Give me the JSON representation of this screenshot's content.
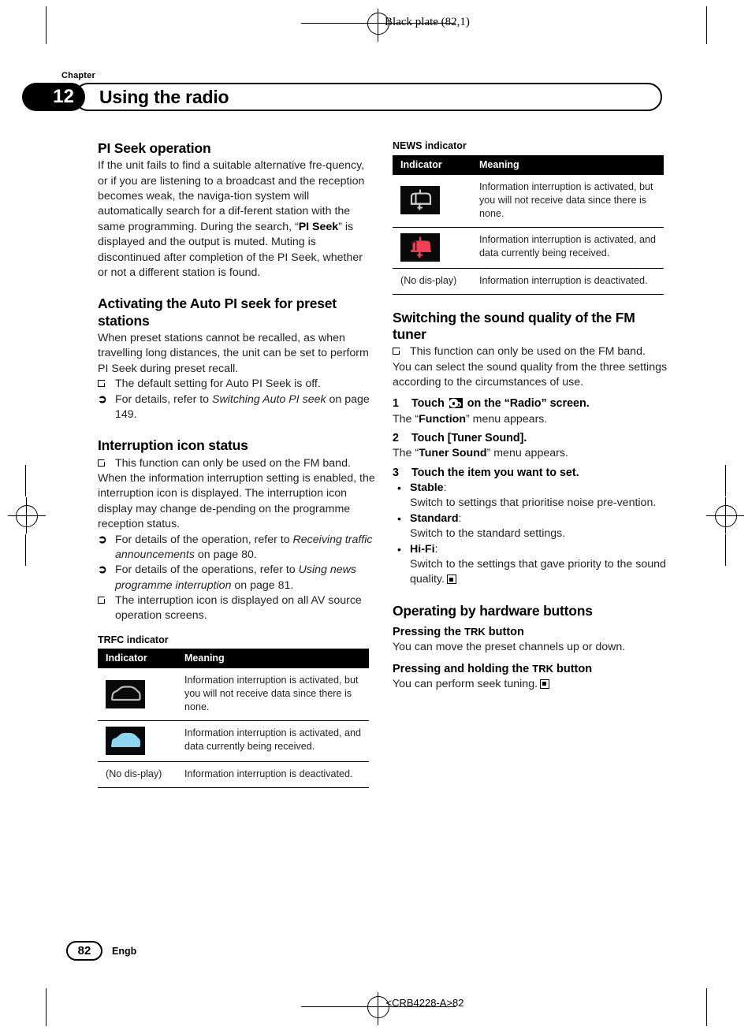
{
  "page": {
    "black_plate": "Black plate (82,1)",
    "chapter_word": "Chapter",
    "chapter_number": "12",
    "chapter_title": "Using the radio",
    "page_number": "82",
    "language_code": "Engb",
    "bottom_code": "<CRB4228-A>82"
  },
  "left_column": {
    "pi_seek": {
      "heading": "PI Seek operation",
      "body_1": "If the unit fails to find a suitable alternative fre-quency, or if you are listening to a broadcast and the reception becomes weak, the naviga-tion system will automatically search for a dif-ferent station with the same programming. During the search, “",
      "bold_1": "PI Seek",
      "body_2": "” is displayed and the output is muted. Muting is discontinued after completion of the PI Seek, whether or not a different station is found."
    },
    "auto_pi": {
      "heading": "Activating the Auto PI seek for preset stations",
      "body": "When preset stations cannot be recalled, as when travelling long distances, the unit can be set to perform PI Seek during preset recall.",
      "note_1": "The default setting for Auto PI Seek is off.",
      "note_2_pre": "For details, refer to ",
      "note_2_italic": "Switching Auto PI seek",
      "note_2_post": " on page 149."
    },
    "interruption": {
      "heading": "Interruption icon status",
      "note_1": "This function can only be used on the FM band.",
      "body": "When the information interruption setting is enabled, the interruption icon is displayed. The interruption icon display may change de-pending on the programme reception status.",
      "note_2_pre": "For details of the operation, refer to ",
      "note_2_italic": "Receiving traffic announcements",
      "note_2_post": " on page 80.",
      "note_3_pre": "For details of the operations, refer to ",
      "note_3_italic": "Using news programme interruption",
      "note_3_post": " on page 81.",
      "note_4": "The interruption icon is displayed on all AV source operation screens."
    },
    "trfc_table": {
      "caption": "TRFC indicator",
      "columns": [
        "Indicator",
        "Meaning"
      ],
      "rows": [
        {
          "icon": "car-outline-icon",
          "icon_label": "",
          "meaning": "Information interruption is activated, but you will not receive data since there is none."
        },
        {
          "icon": "car-filled-icon",
          "icon_label": "",
          "meaning": "Information interruption is activated, and data currently being received."
        },
        {
          "icon": "",
          "icon_label": "(No dis-play)",
          "meaning": "Information interruption is deactivated."
        }
      ]
    }
  },
  "right_column": {
    "news_table": {
      "caption": "NEWS indicator",
      "columns": [
        "Indicator",
        "Meaning"
      ],
      "rows": [
        {
          "icon": "mailbox-outline-icon",
          "icon_label": "",
          "meaning": "Information interruption is activated, but you will not receive data since there is none."
        },
        {
          "icon": "mailbox-filled-icon",
          "icon_label": "",
          "meaning": "Information interruption is activated, and data currently being received."
        },
        {
          "icon": "",
          "icon_label": "(No dis-play)",
          "meaning": "Information interruption is deactivated."
        }
      ]
    },
    "sound_quality": {
      "heading": "Switching the sound quality of the FM tuner",
      "note_1": "This function can only be used on the FM band.",
      "body": "You can select the sound quality from the three settings according to the circumstances of use.",
      "steps": [
        {
          "number": "1",
          "text_pre": "Touch ",
          "icon": "gear-icon",
          "text_post": " on the “Radio” screen.",
          "sub_pre": "The “",
          "sub_bold": "Function",
          "sub_post": "” menu appears."
        },
        {
          "number": "2",
          "text_pre": "Touch [Tuner Sound].",
          "icon": "",
          "text_post": "",
          "sub_pre": "The “",
          "sub_bold": "Tuner Sound",
          "sub_post": "” menu appears."
        },
        {
          "number": "3",
          "text_pre": "Touch the item you want to set.",
          "icon": "",
          "text_post": "",
          "sub_pre": "",
          "sub_bold": "",
          "sub_post": ""
        }
      ],
      "options": [
        {
          "label": "Stable",
          "colon": ":",
          "description": "Switch to settings that prioritise noise pre-vention."
        },
        {
          "label": "Standard",
          "colon": ":",
          "description": "Switch to the standard settings."
        },
        {
          "label": "Hi-Fi",
          "colon": ":",
          "description": "Switch to the settings that gave priority to the sound quality."
        }
      ]
    },
    "hardware": {
      "heading": "Operating by hardware buttons",
      "sub_1_pre": "Pressing the ",
      "sub_1_trk": "TRK",
      "sub_1_post": " button",
      "body_1": "You can move the preset channels up or down.",
      "sub_2_pre": "Pressing and holding the ",
      "sub_2_trk": "TRK",
      "sub_2_post": " button",
      "body_2": "You can perform seek tuning."
    }
  },
  "colors": {
    "text": "#231f20",
    "tile_background": "#0a0a0a",
    "car_filled": "#8ed5f0",
    "car_outline": "#b9b9b9",
    "mailbox_filled": "#ef4056",
    "mailbox_outline": "#cfcfcf"
  }
}
